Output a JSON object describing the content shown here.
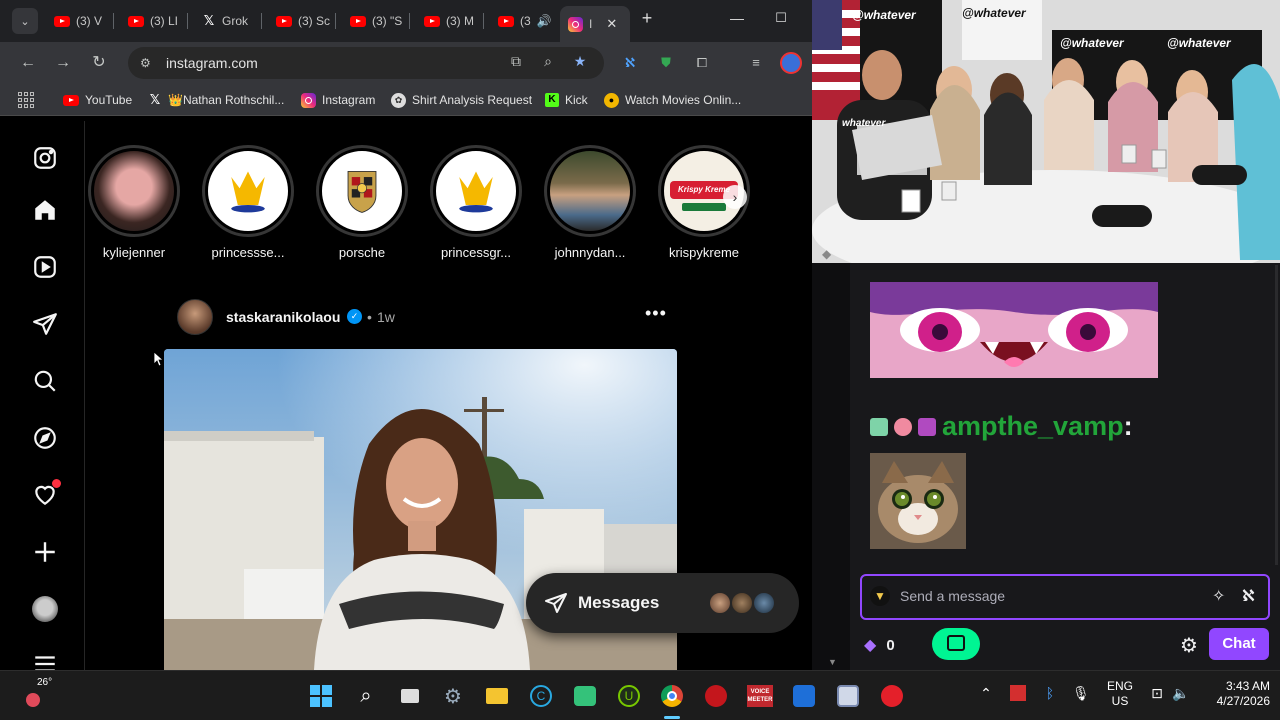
{
  "browser": {
    "tabs": [
      {
        "label": "(3) V",
        "icon": "youtube-icon"
      },
      {
        "label": "(3) LI",
        "icon": "youtube-icon"
      },
      {
        "label": "Grok",
        "icon": "x-icon"
      },
      {
        "label": "(3) Sc",
        "icon": "youtube-icon"
      },
      {
        "label": "(3) \"S",
        "icon": "youtube-icon"
      },
      {
        "label": "(3) M",
        "icon": "youtube-icon"
      },
      {
        "label": "(3",
        "icon": "youtube-icon"
      },
      {
        "label": "I",
        "icon": "instagram-icon",
        "active": true
      }
    ],
    "url": "instagram.com",
    "bookmarks": [
      {
        "label": "YouTube",
        "icon": "youtube-icon"
      },
      {
        "label": "👑Nathan Rothschil...",
        "icon": "x-icon"
      },
      {
        "label": "Instagram",
        "icon": "instagram-icon"
      },
      {
        "label": "Shirt Analysis Request",
        "icon": "shirt-icon"
      },
      {
        "label": "Kick",
        "icon": "kick-icon"
      },
      {
        "label": "Watch Movies Onlin...",
        "icon": "movie-icon"
      }
    ]
  },
  "instagram": {
    "stories": [
      {
        "name": "kyliejenner"
      },
      {
        "name": "princessse..."
      },
      {
        "name": "porsche"
      },
      {
        "name": "princessgr..."
      },
      {
        "name": "johnnydan..."
      },
      {
        "name": "krispykreme"
      }
    ],
    "krispy_logo_text": "Krispy Kreme",
    "post": {
      "username": "staskaranikolaou",
      "dot": "•",
      "time": "1w",
      "more": "•••"
    },
    "messages_label": "Messages"
  },
  "stream": {
    "webcam_banner": "@whatever",
    "mug_text": "whatever"
  },
  "chat": {
    "username": "ampthe_vamp",
    "colon": ":",
    "username_color": "#22a53a",
    "input_placeholder": "Send a message",
    "points": "0",
    "chat_button": "Chat",
    "accent": "#9147ff"
  },
  "taskbar": {
    "weather": "26°",
    "voice_app": "VOICE\nMEETER",
    "lang_line1": "ENG",
    "lang_line2": "US",
    "time": "3:43 AM",
    "date": "4/27/2026"
  }
}
